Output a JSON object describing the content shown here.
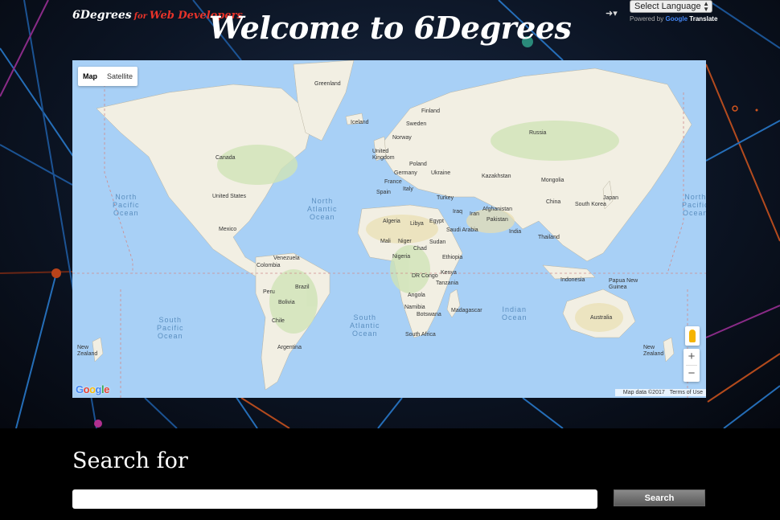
{
  "brand": {
    "name": "6Degrees",
    "connector": "for",
    "tagline": "Web Developers"
  },
  "page_title": "Welcome to 6Degrees",
  "translate": {
    "select_label": "Select Language",
    "powered_by": "Powered by",
    "google": "Google",
    "translate": "Translate"
  },
  "map": {
    "type_buttons": {
      "map": "Map",
      "satellite": "Satellite"
    },
    "oceans": {
      "north_pacific_left": "North\nPacific\nOcean",
      "north_pacific_right": "North\nPacific\nOcean",
      "north_atlantic": "North\nAtlantic\nOcean",
      "south_pacific": "South\nPacific\nOcean",
      "south_atlantic": "South\nAtlantic\nOcean",
      "indian": "Indian\nOcean"
    },
    "places": {
      "greenland": "Greenland",
      "iceland": "Iceland",
      "finland": "Finland",
      "sweden": "Sweden",
      "norway": "Norway",
      "russia": "Russia",
      "canada": "Canada",
      "united_kingdom": "United\nKingdom",
      "poland": "Poland",
      "germany": "Germany",
      "ukraine": "Ukraine",
      "france": "France",
      "kazakhstan": "Kazakhstan",
      "mongolia": "Mongolia",
      "italy": "Italy",
      "spain": "Spain",
      "united_states": "United States",
      "turkey": "Turkey",
      "china": "China",
      "japan": "Japan",
      "south_korea": "South Korea",
      "iraq": "Iraq",
      "iran": "Iran",
      "afghanistan": "Afghanistan",
      "algeria": "Algeria",
      "libya": "Libya",
      "egypt": "Egypt",
      "pakistan": "Pakistan",
      "saudi_arabia": "Saudi Arabia",
      "mexico": "Mexico",
      "india": "India",
      "mali": "Mali",
      "niger": "Niger",
      "sudan": "Sudan",
      "chad": "Chad",
      "thailand": "Thailand",
      "venezuela": "Venezuela",
      "nigeria": "Nigeria",
      "ethiopia": "Ethiopia",
      "colombia": "Colombia",
      "dr_congo": "DR Congo",
      "kenya": "Kenya",
      "indonesia": "Indonesia",
      "papua_new_guinea": "Papua New\nGuinea",
      "tanzania": "Tanzania",
      "peru": "Peru",
      "brazil": "Brazil",
      "angola": "Angola",
      "bolivia": "Bolivia",
      "namibia": "Namibia",
      "madagascar": "Madagascar",
      "botswana": "Botswana",
      "chile": "Chile",
      "australia": "Australia",
      "south_africa": "South Africa",
      "argentina": "Argentina",
      "new_zealand_left": "New\nZealand",
      "new_zealand_right": "New\nZealand"
    },
    "zoom_in": "+",
    "zoom_out": "−",
    "logo": "Google",
    "attribution": {
      "data": "Map data ©2017",
      "terms": "Terms of Use"
    }
  },
  "search": {
    "heading": "Search for",
    "input_value": "",
    "input_placeholder": "",
    "button_label": "Search"
  },
  "colors": {
    "land": "#f2efe3",
    "land_green": "#cfe3b6",
    "water": "#a8d0f6",
    "accent_red": "#e8332a"
  }
}
